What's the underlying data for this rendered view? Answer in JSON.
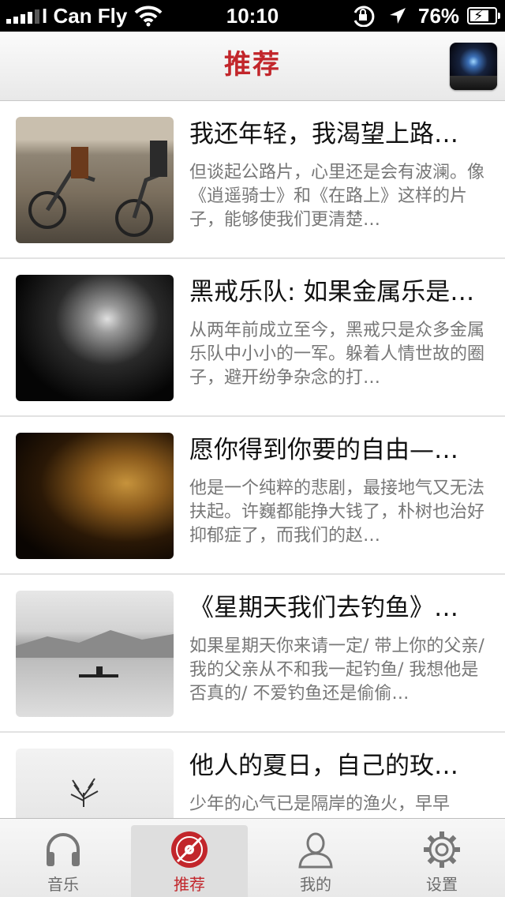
{
  "status_bar": {
    "carrier": "I Can Fly",
    "time": "10:10",
    "battery_text": "76%",
    "battery_level": 0.76
  },
  "nav": {
    "title": "推荐"
  },
  "articles": [
    {
      "title": "我还年轻，我渴望上路…",
      "summary": "但谈起公路片，心里还是会有波澜。像《逍遥骑士》和《在路上》这样的片子，能够使我们更清楚…"
    },
    {
      "title": "黑戒乐队: 如果金属乐是…",
      "summary": "从两年前成立至今，黑戒只是众多金属乐队中小小的一军。躲着人情世故的圈子，避开纷争杂念的打…"
    },
    {
      "title": "愿你得到你要的自由—…",
      "summary": "他是一个纯粹的悲剧，最接地气又无法扶起。许巍都能挣大钱了，朴树也治好抑郁症了，而我们的赵…"
    },
    {
      "title": "《星期天我们去钓鱼》…",
      "summary": "如果星期天你来请一定/ 带上你的父亲/ 我的父亲从不和我一起钓鱼/ 我想他是否真的/ 不爱钓鱼还是偷偷…"
    },
    {
      "title": "他人的夏日，自己的玫…",
      "summary": "少年的心气已是隔岸的渔火，早早"
    }
  ],
  "tabs": [
    {
      "label": "音乐",
      "icon": "headphones-icon"
    },
    {
      "label": "推荐",
      "icon": "vinyl-record-icon",
      "active": true
    },
    {
      "label": "我的",
      "icon": "user-icon"
    },
    {
      "label": "设置",
      "icon": "gear-icon"
    }
  ],
  "colors": {
    "accent": "#c2262b",
    "tab_inactive": "#6d6d6d"
  }
}
